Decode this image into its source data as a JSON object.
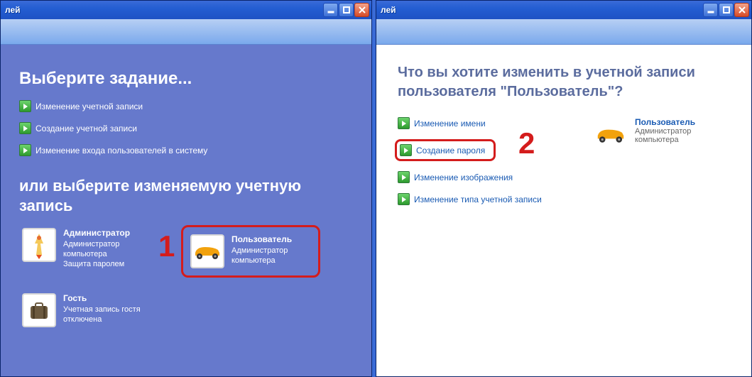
{
  "left": {
    "title_suffix": "лей",
    "h1": "Выберите задание...",
    "tasks": [
      "Изменение учетной записи",
      "Создание учетной записи",
      "Изменение входа пользователей в систему"
    ],
    "h2": "или выберите изменяемую учетную запись",
    "accounts": [
      {
        "name": "Администратор",
        "lines": [
          "Администратор",
          "компьютера",
          "Защита паролем"
        ],
        "icon": "rocket"
      },
      {
        "name": "Пользователь",
        "lines": [
          "Администратор",
          "компьютера"
        ],
        "icon": "car",
        "highlighted": true
      },
      {
        "name": "Гость",
        "lines": [
          "Учетная запись гостя",
          "отключена"
        ],
        "icon": "suitcase"
      }
    ],
    "annot_num": "1"
  },
  "right": {
    "title_suffix": "лей",
    "h1": "Что вы хотите изменить в учетной записи пользователя \"Пользователь\"?",
    "tasks": [
      {
        "label": "Изменение имени",
        "highlighted": false
      },
      {
        "label": "Создание пароля",
        "highlighted": true
      },
      {
        "label": "Изменение изображения",
        "highlighted": false
      },
      {
        "label": "Изменение типа учетной записи",
        "highlighted": false
      }
    ],
    "user": {
      "name": "Пользователь",
      "desc": "Администратор компьютера"
    },
    "annot_num": "2"
  }
}
